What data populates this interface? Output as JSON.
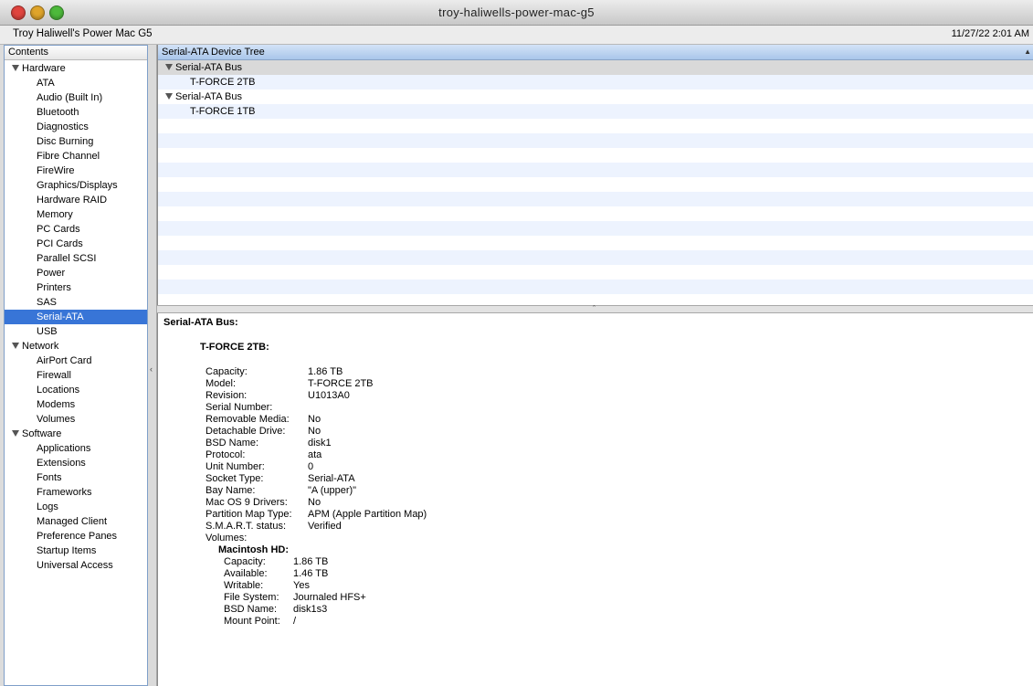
{
  "window": {
    "title": "troy-haliwells-power-mac-g5"
  },
  "infobar": {
    "machine": "Troy Haliwell's Power Mac G5",
    "datetime": "11/27/22 2:01 AM"
  },
  "sidebar": {
    "header": "Contents",
    "groups": [
      {
        "label": "Hardware",
        "items": [
          "ATA",
          "Audio (Built In)",
          "Bluetooth",
          "Diagnostics",
          "Disc Burning",
          "Fibre Channel",
          "FireWire",
          "Graphics/Displays",
          "Hardware RAID",
          "Memory",
          "PC Cards",
          "PCI Cards",
          "Parallel SCSI",
          "Power",
          "Printers",
          "SAS",
          "Serial-ATA",
          "USB"
        ]
      },
      {
        "label": "Network",
        "items": [
          "AirPort Card",
          "Firewall",
          "Locations",
          "Modems",
          "Volumes"
        ]
      },
      {
        "label": "Software",
        "items": [
          "Applications",
          "Extensions",
          "Fonts",
          "Frameworks",
          "Logs",
          "Managed Client",
          "Preference Panes",
          "Startup Items",
          "Universal Access"
        ]
      }
    ],
    "selected": "Serial-ATA"
  },
  "tree": {
    "header": "Serial-ATA Device Tree",
    "rows": [
      {
        "type": "bus",
        "label": "Serial-ATA Bus"
      },
      {
        "type": "dev",
        "label": "T-FORCE 2TB"
      },
      {
        "type": "bus",
        "label": "Serial-ATA Bus"
      },
      {
        "type": "dev",
        "label": "T-FORCE 1TB"
      }
    ]
  },
  "detail": {
    "bus_title": "Serial-ATA Bus:",
    "device_title": "T-FORCE 2TB:",
    "properties": [
      {
        "k": "Capacity:",
        "v": "1.86 TB"
      },
      {
        "k": "Model:",
        "v": "T-FORCE 2TB"
      },
      {
        "k": "Revision:",
        "v": "U1013A0"
      },
      {
        "k": "Serial Number:",
        "v": ""
      },
      {
        "k": "Removable Media:",
        "v": "No"
      },
      {
        "k": "Detachable Drive:",
        "v": "No"
      },
      {
        "k": "BSD Name:",
        "v": "disk1"
      },
      {
        "k": "Protocol:",
        "v": "ata"
      },
      {
        "k": "Unit Number:",
        "v": "0"
      },
      {
        "k": "Socket Type:",
        "v": "Serial-ATA"
      },
      {
        "k": "Bay Name:",
        "v": "\"A (upper)\""
      },
      {
        "k": "Mac OS 9 Drivers:",
        "v": "No"
      },
      {
        "k": "Partition Map Type:",
        "v": "APM (Apple Partition Map)"
      },
      {
        "k": "S.M.A.R.T. status:",
        "v": "Verified"
      },
      {
        "k": "Volumes:",
        "v": ""
      }
    ],
    "volume_title": "Macintosh HD:",
    "volume_properties": [
      {
        "k": "Capacity:",
        "v": "1.86 TB"
      },
      {
        "k": "Available:",
        "v": "1.46 TB"
      },
      {
        "k": "Writable:",
        "v": "Yes"
      },
      {
        "k": "File System:",
        "v": "Journaled HFS+"
      },
      {
        "k": "BSD Name:",
        "v": "disk1s3"
      },
      {
        "k": "Mount Point:",
        "v": "/"
      }
    ]
  }
}
